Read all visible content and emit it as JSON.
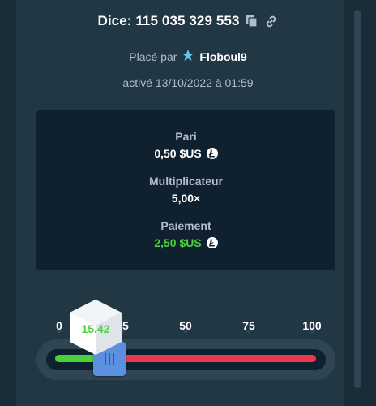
{
  "header": {
    "title": "Dice: 115 035 329 553",
    "copy_icon": "copy-icon",
    "link_icon": "link-icon"
  },
  "placed_by": {
    "prefix": "Placé par",
    "user": "Floboul9",
    "badge_icon": "star-icon"
  },
  "activated": "activé 13/10/2022 à 01:59",
  "stats": {
    "bet_label": "Pari",
    "bet_value": "0,50 $US",
    "multiplier_label": "Multiplicateur",
    "multiplier_value": "5,00×",
    "payout_label": "Paiement",
    "payout_value": "2,50 $US",
    "currency_icon": "litecoin-icon"
  },
  "slider": {
    "ticks": [
      "0",
      "25",
      "50",
      "75",
      "100"
    ],
    "value_percent": 20,
    "range": [
      0,
      100
    ],
    "roll_result": "15.42"
  },
  "colors": {
    "background": "#1a2c38",
    "panel": "#213743",
    "card": "#0f212e",
    "win": "#4ad23a",
    "lose": "#e9384e",
    "handle": "#5b8fe0"
  }
}
